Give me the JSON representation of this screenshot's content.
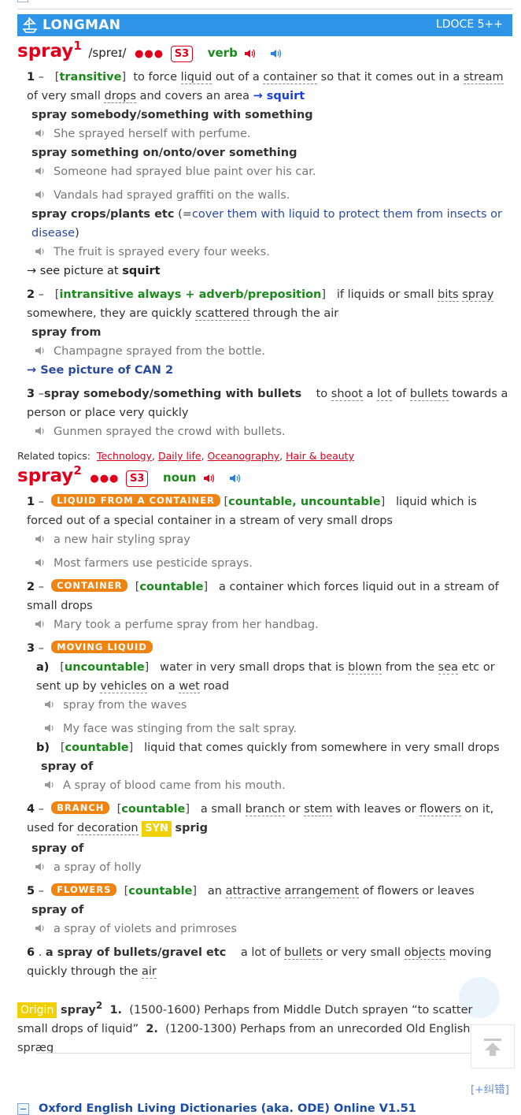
{
  "app": {
    "brand": "LONGMAN",
    "version": "LDOCE 5++"
  },
  "entries": [
    {
      "headword": "spray",
      "hom": "1",
      "pron": "/spreɪ/",
      "dots": "●●●",
      "freq": "S3",
      "pos": "verb",
      "senses": [
        {
          "num": "1",
          "dash": "–",
          "gram": "transitive",
          "def": [
            {
              "t": "to force "
            },
            {
              "t": "liquid",
              "u": true
            },
            {
              "t": " out of a "
            },
            {
              "t": "container",
              "u": true
            },
            {
              "t": " so that it comes out in a "
            },
            {
              "t": "stream",
              "u": true
            },
            {
              "t": " of very small "
            },
            {
              "t": "drops",
              "u": true
            },
            {
              "t": " and covers an area "
            }
          ],
          "xref": "→ squirt"
        },
        {
          "num": "2",
          "dash": "–",
          "gram": "intransitive always + adverb/preposition",
          "def": [
            {
              "t": "if liquids or small "
            },
            {
              "t": "bits",
              "u": true
            },
            {
              "t": " "
            },
            {
              "t": "spray",
              "u": true
            },
            {
              "t": " somewhere, they are quickly "
            },
            {
              "t": "scattered",
              "u": true
            },
            {
              "t": " through the air"
            }
          ]
        },
        {
          "num": "3",
          "dash": "–",
          "phrase": "spray somebody/something with bullets",
          "def": [
            {
              "t": "to "
            },
            {
              "t": "shoot",
              "u": true
            },
            {
              "t": " a "
            },
            {
              "t": "lot",
              "u": true
            },
            {
              "t": " of "
            },
            {
              "t": "bullets",
              "u": true
            },
            {
              "t": " towards a person or place very quickly"
            }
          ]
        }
      ],
      "colloc": [
        "spray somebody/something with something",
        "spray something on/onto/over something",
        "spray crops/plants etc",
        "spray from"
      ],
      "gloss": "(=cover them with liquid to protect them from insects or disease)",
      "gloss_eq": "(=",
      "gloss_text": "cover them with liquid to protect them from insects or disease",
      "gloss_close": ")",
      "examples": [
        "She sprayed herself with perfume.",
        "Someone had sprayed blue paint over his car.",
        "Vandals had sprayed graffiti on the walls.",
        "The fruit is sprayed every four weeks.",
        "Champagne sprayed from the bottle.",
        "Gunmen sprayed the crowd with bullets."
      ],
      "see_picture": {
        "prefix": "→ see picture at",
        "target": "squirt"
      },
      "see_can": "→  See picture of CAN 2"
    },
    {
      "headword": "spray",
      "hom": "2",
      "dots": "●●●",
      "freq": "S3",
      "pos": "noun",
      "related_label": "Related topics:",
      "related": [
        "Technology",
        "Daily life",
        "Oceanography",
        "Hair & beauty"
      ],
      "related_sep": ", ",
      "senses": [
        {
          "num": "1",
          "dash": "–",
          "label": "LIQUID FROM A CONTAINER",
          "gram": "countable, uncountable",
          "def": [
            {
              "t": "liquid which is forced out of a special container in a stream of very small drops"
            }
          ]
        },
        {
          "num": "2",
          "dash": "–",
          "label": "CONTAINER",
          "gram": "countable",
          "def": [
            {
              "t": "a container which forces liquid out in a stream of small drops"
            }
          ]
        },
        {
          "num": "3",
          "dash": "–",
          "label": "MOVING LIQUID",
          "sub": [
            {
              "letter": "a)",
              "gram": "uncountable",
              "def": [
                {
                  "t": "water in very small drops that is "
                },
                {
                  "t": "blown",
                  "u": true
                },
                {
                  "t": " from the "
                },
                {
                  "t": "sea",
                  "u": true
                },
                {
                  "t": " etc or sent up by "
                },
                {
                  "t": "vehicles",
                  "u": true
                },
                {
                  "t": " on a "
                },
                {
                  "t": "wet",
                  "u": true
                },
                {
                  "t": " road"
                }
              ]
            },
            {
              "letter": "b)",
              "gram": "countable",
              "def": [
                {
                  "t": "liquid that comes quickly from somewhere in very small drops"
                }
              ]
            }
          ]
        },
        {
          "num": "4",
          "dash": "–",
          "label": "BRANCH",
          "gram": "countable",
          "def": [
            {
              "t": "a small "
            },
            {
              "t": "branch",
              "u": true
            },
            {
              "t": " or "
            },
            {
              "t": "stem",
              "u": true
            },
            {
              "t": " with leaves or "
            },
            {
              "t": "flowers",
              "u": true
            },
            {
              "t": " on it, used for "
            },
            {
              "t": "decoration",
              "u": true
            },
            {
              "t": " "
            }
          ],
          "syn_tag": "SYN",
          "syn": "sprig"
        },
        {
          "num": "5",
          "dash": "–",
          "label": "FLOWERS",
          "gram": "countable",
          "def": [
            {
              "t": "an "
            },
            {
              "t": "attractive",
              "u": true
            },
            {
              "t": " "
            },
            {
              "t": "arrangement",
              "u": true
            },
            {
              "t": " of flowers or leaves"
            }
          ]
        },
        {
          "num": "6",
          "dash": ".",
          "phrase": "a spray of bullets/gravel etc",
          "def": [
            {
              "t": "a lot of "
            },
            {
              "t": "bullets",
              "u": true
            },
            {
              "t": " or very small "
            },
            {
              "t": "objects",
              "u": true
            },
            {
              "t": " moving quickly through the "
            },
            {
              "t": "air",
              "u": true
            }
          ]
        }
      ],
      "colloc": [
        "spray of",
        "spray of",
        "spray of"
      ],
      "examples": [
        "a new hair styling spray",
        "Most farmers use pesticide sprays.",
        "Mary took a perfume spray from her handbag.",
        "spray from the waves",
        "My face was stinging from the salt spray.",
        "A spray of blood came from his mouth.",
        "a spray of holly",
        "a spray of violets and primroses"
      ]
    }
  ],
  "origin": {
    "tag": "Origin",
    "word": "spray",
    "hom": "2",
    "n1": "1.",
    "t1": "(1500-1600) Perhaps from Middle Dutch sprayen “to scatter small drops of liquid”",
    "n2": "2.",
    "t2": "(1200-1300) Perhaps from an unrecorded Old English spræg"
  },
  "footer": {
    "correct": "[+纠错]",
    "next_dict": "Oxford English Living Dictionaries (aka. ODE) Online V1.51"
  },
  "colors": {
    "accent_red": "#e0001b",
    "banner_blue": "#2f95e8",
    "gram_green": "#1a8a1a",
    "label_orange": "#f08413",
    "syn_yellow": "#f1d000",
    "link_blue": "#1a3fd8"
  },
  "icons": {
    "speaker_british": "speaker-red-icon",
    "speaker_american": "speaker-blue-icon",
    "example_audio": "speaker-gray-icon",
    "logo": "longman-ship-icon",
    "to_top": "arrow-up-icon",
    "collapse": "minus-box-icon"
  }
}
